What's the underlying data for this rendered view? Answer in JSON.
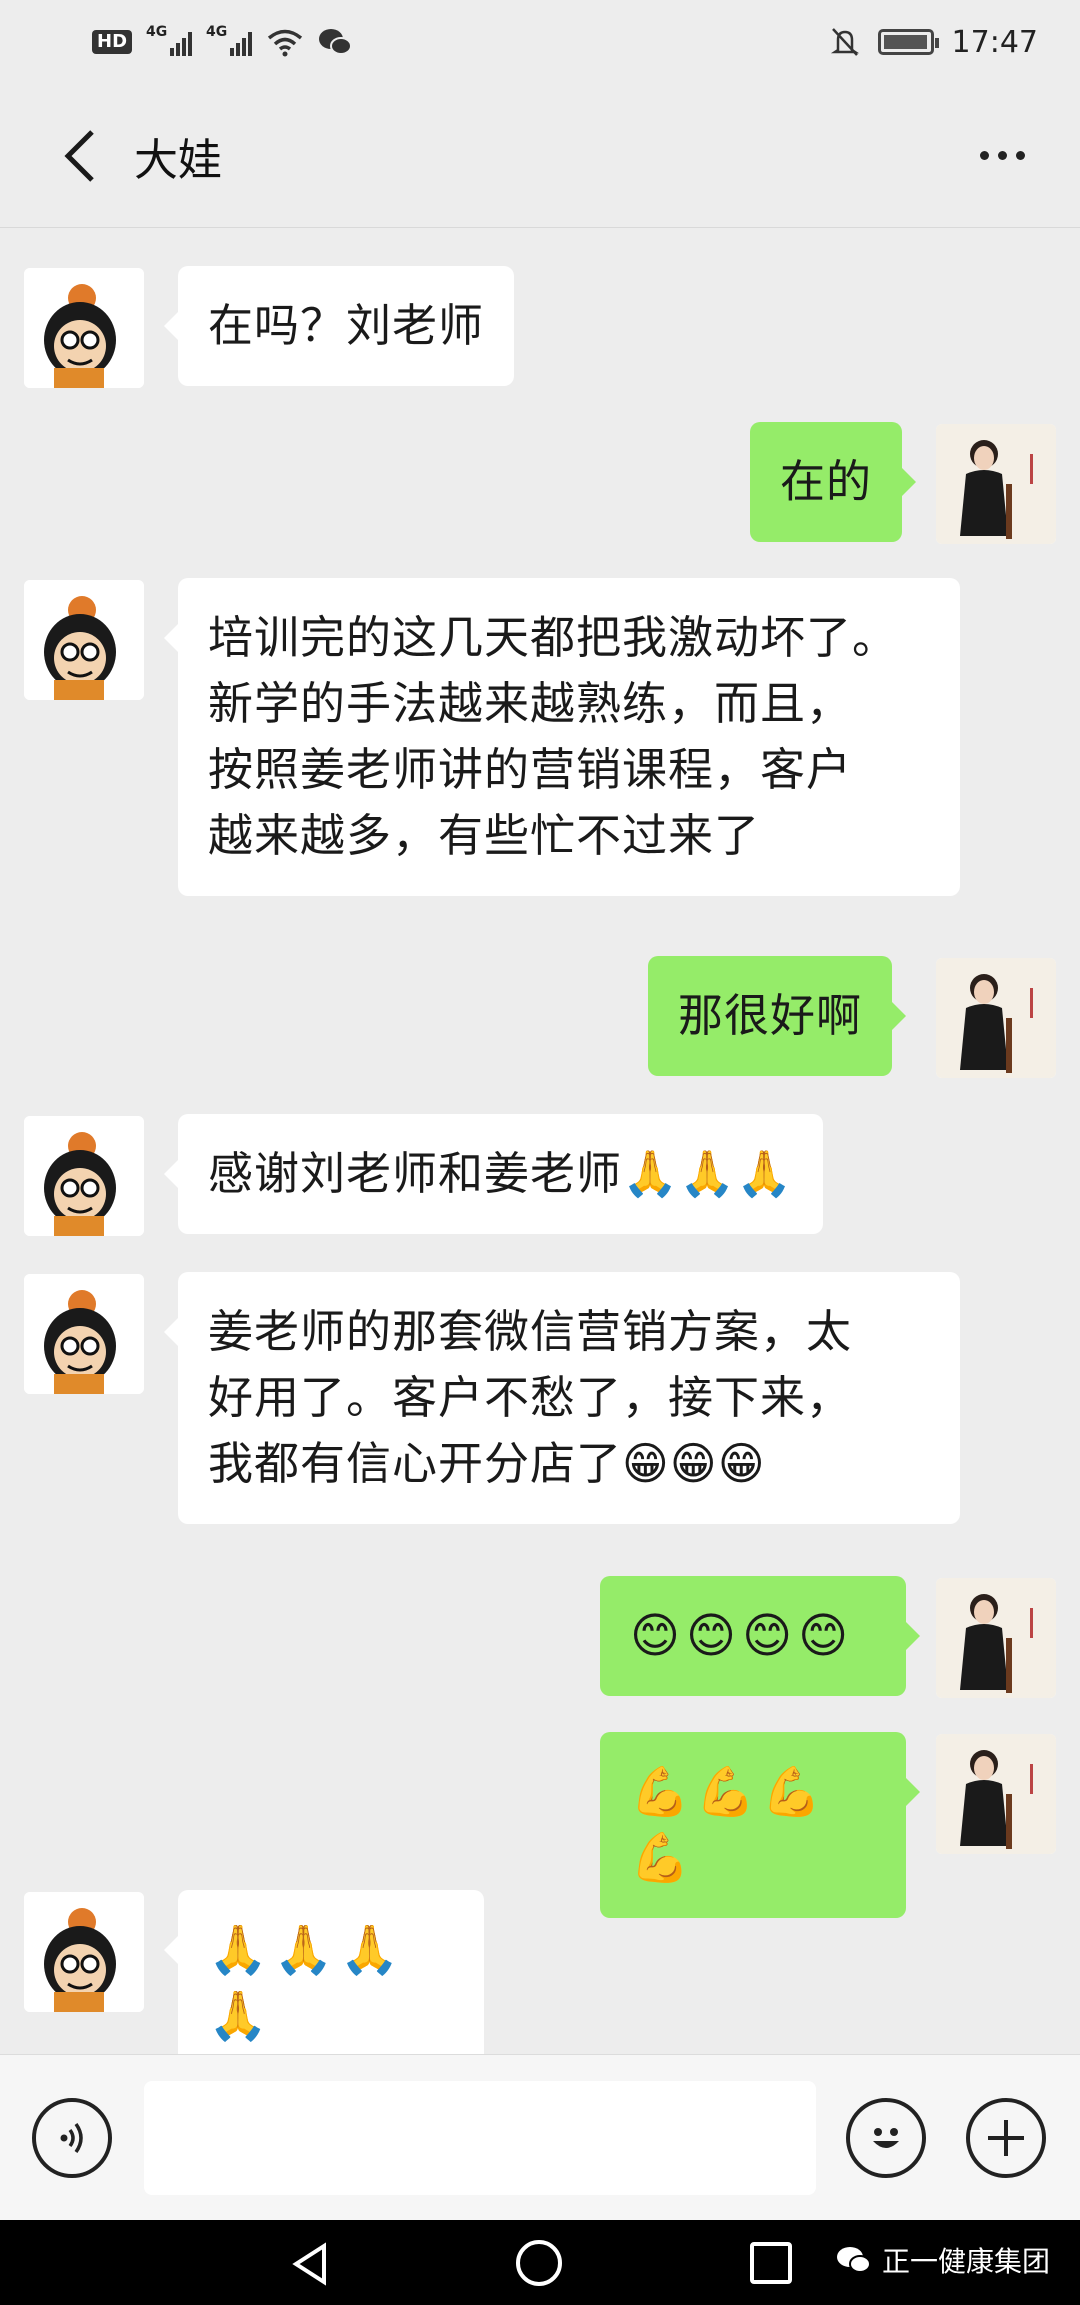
{
  "status_bar": {
    "hd": "HD",
    "signal1": "4G",
    "signal2": "4G",
    "time": "17:47"
  },
  "header": {
    "title": "大娃"
  },
  "messages": [
    {
      "side": "in",
      "text": "在吗？刘老师"
    },
    {
      "side": "out",
      "text": "在的"
    },
    {
      "side": "in",
      "text": "培训完的这几天都把我激动坏了。\n新学的手法越来越熟练，而且，\n按照姜老师讲的营销课程，客户\n越来越多，有些忙不过来了"
    },
    {
      "side": "out",
      "text": "那很好啊"
    },
    {
      "side": "in",
      "text": "感谢刘老师和姜老师🙏🙏🙏"
    },
    {
      "side": "in",
      "text": "姜老师的那套微信营销方案，太\n好用了。客户不愁了，接下来，\n我都有信心开分店了😁😁😁"
    },
    {
      "side": "out",
      "text": "😊😊😊😊"
    },
    {
      "side": "out",
      "text": "💪💪💪💪"
    },
    {
      "side": "in",
      "text": "🙏🙏🙏🙏"
    }
  ],
  "input": {
    "placeholder": ""
  },
  "watermark": "正一健康集团",
  "icons": {
    "back": "chevron-left-icon",
    "more": "more-dots-icon",
    "voice": "voice-icon",
    "emoji": "emoji-icon",
    "plus": "plus-icon"
  },
  "colors": {
    "background": "#ededed",
    "bubble_out": "#95ec69",
    "bubble_in": "#ffffff"
  }
}
